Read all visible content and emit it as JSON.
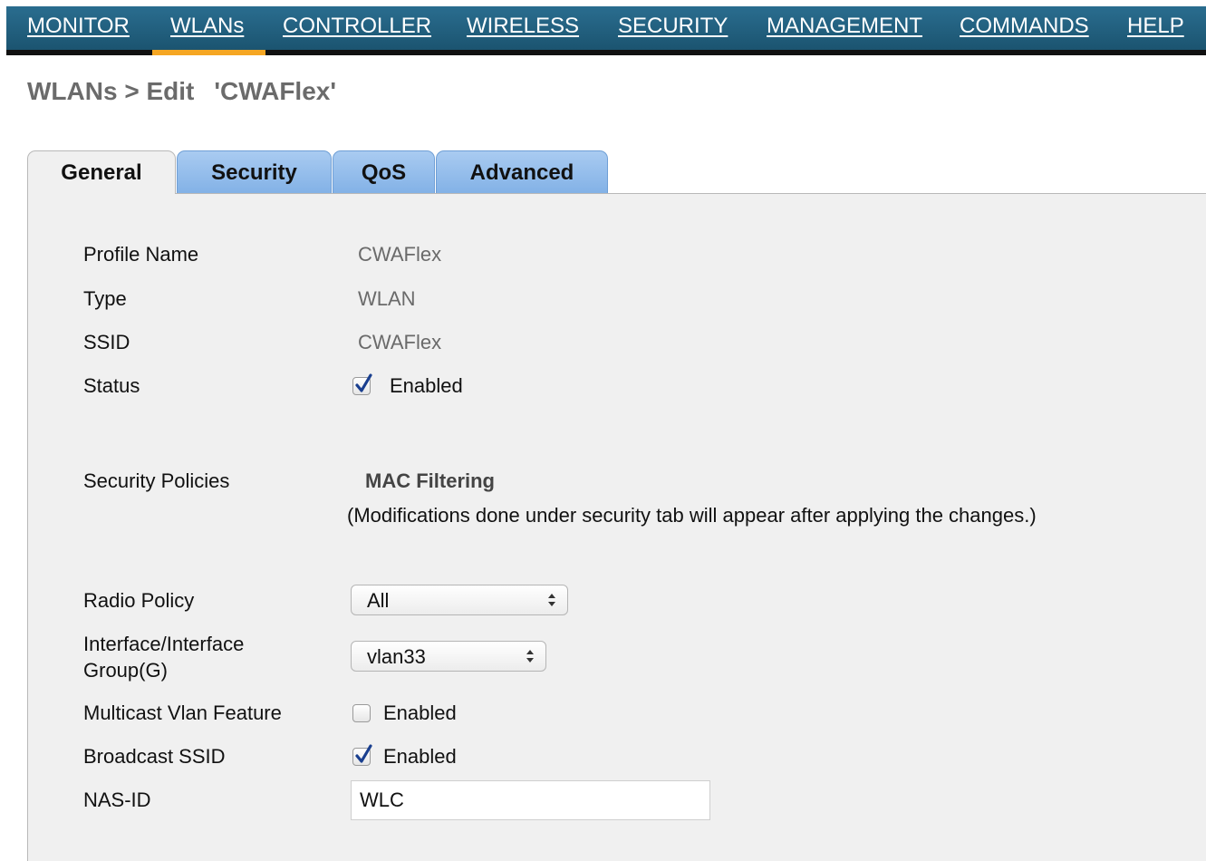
{
  "nav": {
    "items": [
      {
        "label": "MONITOR"
      },
      {
        "label": "WLANs"
      },
      {
        "label": "CONTROLLER"
      },
      {
        "label": "WIRELESS"
      },
      {
        "label": "SECURITY"
      },
      {
        "label": "MANAGEMENT"
      },
      {
        "label": "COMMANDS"
      },
      {
        "label": "HELP"
      }
    ],
    "active": "WLANs",
    "active_color": "#f5a623"
  },
  "heading": {
    "prefix": "WLANs > Edit",
    "name": "'CWAFlex'"
  },
  "tabs": [
    {
      "label": "General"
    },
    {
      "label": "Security"
    },
    {
      "label": "QoS"
    },
    {
      "label": "Advanced"
    }
  ],
  "form": {
    "profile_name": {
      "label": "Profile Name",
      "value": "CWAFlex"
    },
    "type": {
      "label": "Type",
      "value": "WLAN"
    },
    "ssid": {
      "label": "SSID",
      "value": "CWAFlex"
    },
    "status": {
      "label": "Status",
      "checkbox_label": "Enabled",
      "checked": true
    },
    "security_policies": {
      "label": "Security Policies",
      "value": "MAC Filtering",
      "note": "(Modifications done under security tab will appear after applying the changes.)"
    },
    "radio_policy": {
      "label": "Radio Policy",
      "value": "All"
    },
    "interface": {
      "label_line1": "Interface/Interface",
      "label_line2": "Group(G)",
      "value": "vlan33"
    },
    "multicast": {
      "label": "Multicast Vlan Feature",
      "checkbox_label": "Enabled",
      "checked": false
    },
    "broadcast_ssid": {
      "label": "Broadcast SSID",
      "checkbox_label": "Enabled",
      "checked": true
    },
    "nas_id": {
      "label": "NAS-ID",
      "value": "WLC"
    }
  },
  "icons": {
    "check": "checkmark-icon",
    "select_arrows": "up-down-arrows-icon"
  },
  "colors": {
    "nav_bg": "#1f5f80",
    "tab_inactive": "#95bdeb",
    "panel_bg": "#f0f0f0",
    "check": "#1a3f8f"
  }
}
